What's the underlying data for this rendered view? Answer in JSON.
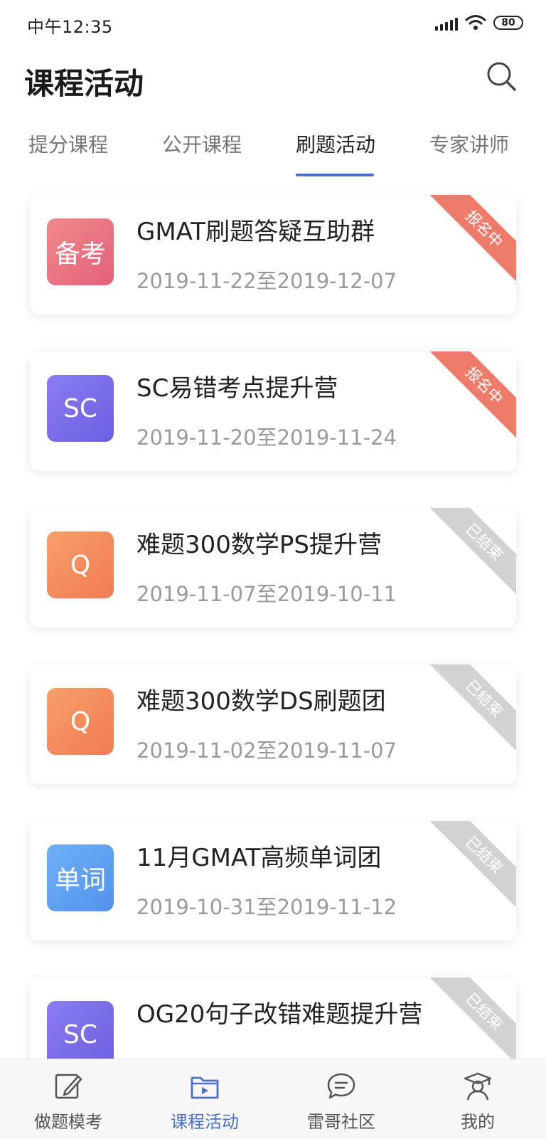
{
  "status_bar": {
    "time": "中午12:35",
    "battery": "80"
  },
  "header": {
    "title": "课程活动",
    "search_icon": "search-icon"
  },
  "tabs": [
    {
      "label": "提分课程",
      "active": false
    },
    {
      "label": "公开课程",
      "active": false
    },
    {
      "label": "刷题活动",
      "active": true
    },
    {
      "label": "专家讲师",
      "active": false
    }
  ],
  "activities": [
    {
      "icon_text": "备考",
      "title": "GMAT刷题答疑互助群",
      "date": "2019-11-22至2019-12-07",
      "status": "报名中",
      "status_color": "#ef7b6a",
      "icon_colors": [
        "#f08a8a",
        "#e3607a"
      ]
    },
    {
      "icon_text": "SC",
      "title": "SC易错考点提升营",
      "date": "2019-11-20至2019-11-24",
      "status": "报名中",
      "status_color": "#ef7b6a",
      "icon_colors": [
        "#8a7cf0",
        "#6d5fe0"
      ]
    },
    {
      "icon_text": "Q",
      "title": "难题300数学PS提升营",
      "date": "2019-11-07至2019-10-11",
      "status": "已结束",
      "status_color": "#d2d2d2",
      "icon_colors": [
        "#f7a06a",
        "#f27a52"
      ]
    },
    {
      "icon_text": "Q",
      "title": "难题300数学DS刷题团",
      "date": "2019-11-02至2019-11-07",
      "status": "已结束",
      "status_color": "#d2d2d2",
      "icon_colors": [
        "#f7a06a",
        "#f27a52"
      ]
    },
    {
      "icon_text": "单词",
      "title": "11月GMAT高频单词团",
      "date": "2019-10-31至2019-11-12",
      "status": "已结束",
      "status_color": "#d2d2d2",
      "icon_colors": [
        "#6fb0f5",
        "#5192ee"
      ]
    },
    {
      "icon_text": "SC",
      "title": "OG20句子改错难题提升营",
      "date": "",
      "status": "已结束",
      "status_color": "#d2d2d2",
      "icon_colors": [
        "#8a7cf0",
        "#6d5fe0"
      ]
    }
  ],
  "bottom_nav": [
    {
      "label": "做题模考",
      "icon": "edit-icon",
      "active": false
    },
    {
      "label": "课程活动",
      "icon": "course-folder-icon",
      "active": true
    },
    {
      "label": "雷哥社区",
      "icon": "chat-bubble-icon",
      "active": false
    },
    {
      "label": "我的",
      "icon": "graduate-icon",
      "active": false
    }
  ],
  "colors": {
    "accent": "#4a6fd1",
    "tag_open": "#ef7b6a",
    "tag_closed": "#d2d2d2"
  }
}
